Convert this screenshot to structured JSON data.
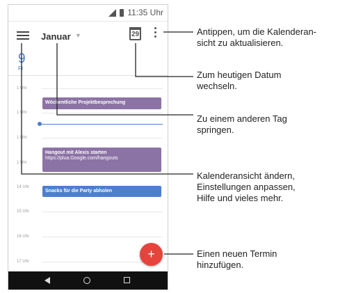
{
  "status_bar": {
    "time": "11:35 Uhr"
  },
  "app_bar": {
    "month": "Januar",
    "today_date": "29"
  },
  "day_header": {
    "day": "9",
    "weekday": "Fr"
  },
  "hours": [
    "1 Uhr",
    "1 Uhr",
    "1 Uhr",
    "1 Uhr",
    "14 Uhr",
    "15 Uhr",
    "16 Uhr",
    "17 Uhr"
  ],
  "events": {
    "meeting": "Wöchentliche Projektbesprechung",
    "hangout_title": "Hangout mit Alexis starten",
    "hangout_link": "https://plua.Google.com/hangouts",
    "snacks": "Snacks für die Party abholen"
  },
  "fab": {
    "symbol": "+"
  },
  "callouts": {
    "refresh": [
      "Antippen, um die Kalenderan-",
      "sicht zu aktualisieren."
    ],
    "today": [
      "Zum heutigen Datum",
      "wechseln."
    ],
    "jump": [
      "Zu einem anderen Tag",
      "springen."
    ],
    "menu": [
      "Kalenderansicht ändern,",
      "Einstellungen anpassen,",
      "Hilfe und vieles mehr."
    ],
    "add": [
      "Einen neuen Termin",
      "hinzufügen."
    ]
  },
  "colors": {
    "event_purple": "#8c73a5",
    "event_blue": "#4d7fcb",
    "fab_red": "#e5443c",
    "accent_blue": "#4a7fc9"
  }
}
